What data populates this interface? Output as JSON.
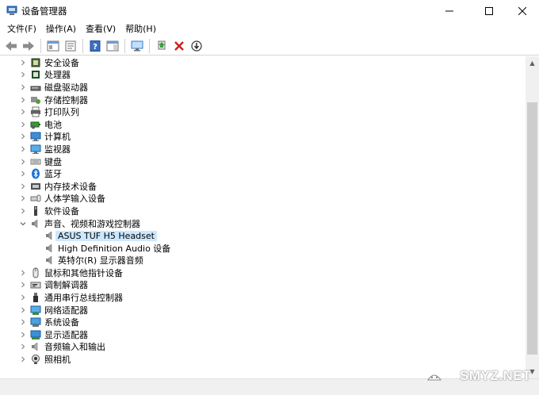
{
  "window": {
    "title": "设备管理器",
    "minimize_glyph": "—",
    "maximize_glyph": "☐",
    "close_glyph": "✕"
  },
  "menu": [
    "文件(F)",
    "操作(A)",
    "查看(V)",
    "帮助(H)"
  ],
  "toolbar": {
    "icons": [
      "back-arrow-icon",
      "forward-arrow-icon",
      "show-hide-console-tree-icon",
      "properties-icon",
      "help-icon",
      "action-pane-icon",
      "monitor-icon",
      "update-driver-icon",
      "uninstall-device-icon",
      "disable-device-icon"
    ]
  },
  "tree": {
    "categories": [
      {
        "label": "安全设备",
        "icon": "security-chip-icon",
        "expanded": false
      },
      {
        "label": "处理器",
        "icon": "processor-icon",
        "expanded": false
      },
      {
        "label": "磁盘驱动器",
        "icon": "disk-drive-icon",
        "expanded": false
      },
      {
        "label": "存储控制器",
        "icon": "storage-controller-icon",
        "expanded": false
      },
      {
        "label": "打印队列",
        "icon": "printer-icon",
        "expanded": false
      },
      {
        "label": "电池",
        "icon": "battery-icon",
        "expanded": false
      },
      {
        "label": "计算机",
        "icon": "computer-icon",
        "expanded": false
      },
      {
        "label": "监视器",
        "icon": "monitor-icon",
        "expanded": false
      },
      {
        "label": "键盘",
        "icon": "keyboard-icon",
        "expanded": false
      },
      {
        "label": "蓝牙",
        "icon": "bluetooth-icon",
        "expanded": false
      },
      {
        "label": "内存技术设备",
        "icon": "memory-icon",
        "expanded": false
      },
      {
        "label": "人体学输入设备",
        "icon": "hid-icon",
        "expanded": false
      },
      {
        "label": "软件设备",
        "icon": "software-device-icon",
        "expanded": false
      },
      {
        "label": "声音、视频和游戏控制器",
        "icon": "speaker-icon",
        "expanded": true,
        "children": [
          {
            "label": "ASUS TUF H5 Headset",
            "icon": "speaker-icon",
            "selected": true
          },
          {
            "label": "High Definition Audio 设备",
            "icon": "speaker-icon",
            "selected": false
          },
          {
            "label": "英特尔(R) 显示器音频",
            "icon": "speaker-icon",
            "selected": false
          }
        ]
      },
      {
        "label": "鼠标和其他指针设备",
        "icon": "mouse-icon",
        "expanded": false
      },
      {
        "label": "调制解调器",
        "icon": "modem-icon",
        "expanded": false
      },
      {
        "label": "通用串行总线控制器",
        "icon": "usb-icon",
        "expanded": false
      },
      {
        "label": "网络适配器",
        "icon": "network-adapter-icon",
        "expanded": false
      },
      {
        "label": "系统设备",
        "icon": "system-device-icon",
        "expanded": false
      },
      {
        "label": "显示适配器",
        "icon": "display-adapter-icon",
        "expanded": false
      },
      {
        "label": "音频输入和输出",
        "icon": "audio-io-icon",
        "expanded": false
      },
      {
        "label": "照相机",
        "icon": "camera-icon",
        "expanded": false
      }
    ]
  },
  "watermark": {
    "text": "SMYZ.NET"
  }
}
